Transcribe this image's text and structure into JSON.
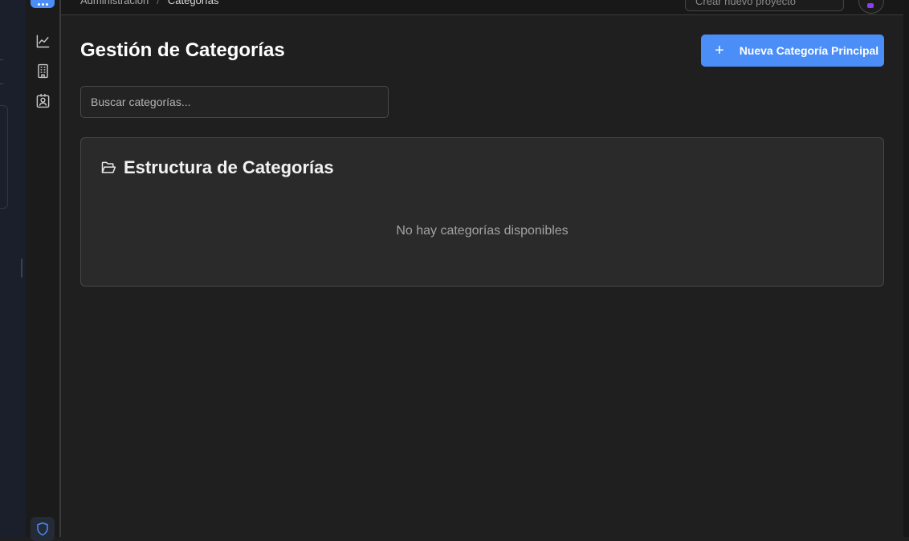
{
  "breadcrumb": {
    "parent": "Administración",
    "current": "Categorías"
  },
  "header": {
    "project_placeholder": "Crear nuevo proyecto"
  },
  "rail": {
    "icons": [
      "chart-line-icon",
      "building-icon",
      "contact-badge-icon",
      "shield-icon"
    ]
  },
  "page": {
    "title": "Gestión de Categorías",
    "new_button_label": "Nueva Categoría Principal",
    "new_button_icon": "+",
    "search_placeholder": "Buscar categorías..."
  },
  "structure": {
    "title": "Estructura de Categorías",
    "empty_message": "No hay categorías disponibles"
  },
  "colors": {
    "accent": "#4b8ef7",
    "background": "#1f1f1f",
    "panel": "#2a2a2a"
  }
}
